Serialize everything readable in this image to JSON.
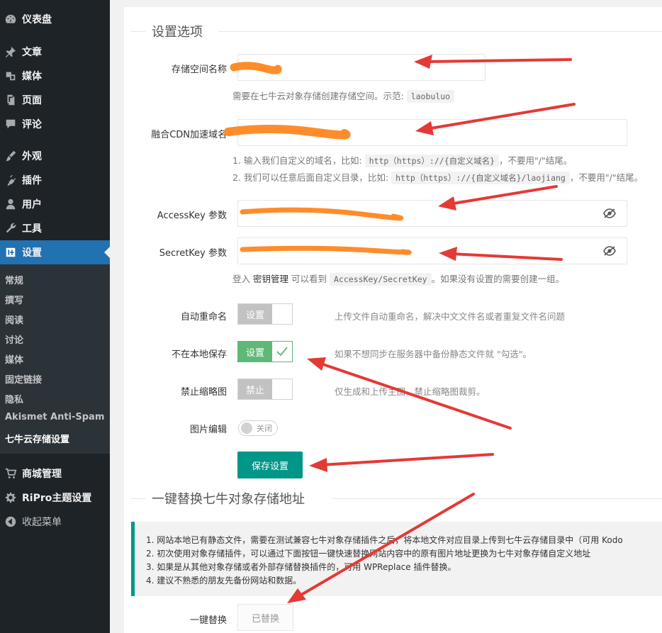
{
  "sidebar": {
    "items": [
      {
        "label": "仪表盘",
        "icon": "dashboard-icon"
      },
      {
        "label": "文章",
        "icon": "pin-icon"
      },
      {
        "label": "媒体",
        "icon": "media-icon"
      },
      {
        "label": "页面",
        "icon": "page-icon"
      },
      {
        "label": "评论",
        "icon": "comment-icon"
      },
      {
        "label": "外观",
        "icon": "brush-icon"
      },
      {
        "label": "插件",
        "icon": "plugin-icon"
      },
      {
        "label": "用户",
        "icon": "user-icon"
      },
      {
        "label": "工具",
        "icon": "wrench-icon"
      },
      {
        "label": "设置",
        "icon": "settings-icon"
      },
      {
        "label": "商城管理",
        "icon": "cart-icon"
      },
      {
        "label": "RiPro主题设置",
        "icon": "gear-icon"
      },
      {
        "label": "收起菜单",
        "icon": "collapse-icon"
      }
    ],
    "submenu": [
      "常规",
      "撰写",
      "阅读",
      "讨论",
      "媒体",
      "固定链接",
      "隐私",
      "Akismet Anti-Spam",
      "七牛云存储设置"
    ]
  },
  "settings": {
    "legend": "设置选项",
    "bucket": {
      "label": "存储空间名称",
      "help_prefix": "需要在七牛云对象存储创建存储空间。示范:",
      "help_code": "laobuluo"
    },
    "cdn": {
      "label": "融合CDN加速域名",
      "help1_prefix": "1. 输入我们自定义的域名，比如:",
      "help1_code": "http（https）://{自定义域名}",
      "help1_suffix": "，不要用\"/\"结尾。",
      "help2_prefix": "2. 我们可以任意后面自定义目录，比如:",
      "help2_code": "http（https）://{自定义域名}/laojiang",
      "help2_suffix": "，不要用\"/\"结尾。"
    },
    "access_key": {
      "label": "AccessKey 参数"
    },
    "secret_key": {
      "label": "SecretKey 参数"
    },
    "key_help": {
      "prefix": "登入",
      "link": "密钥管理",
      "middle": "可以看到",
      "code": "AccessKey/SecretKey",
      "suffix": "。如果没有设置的需要创建一组。"
    },
    "auto_rename": {
      "label": "自动重命名",
      "switch_text": "设置",
      "checked": false,
      "help": "上传文件自动重命名，解决中文文件名或者重复文件名问题"
    },
    "no_local": {
      "label": "不在本地保存",
      "switch_text": "设置",
      "checked": true,
      "help": "如果不想同步在服务器中备份静态文件就 \"勾选\"。"
    },
    "no_thumb": {
      "label": "禁止缩略图",
      "switch_text": "禁止",
      "checked": false,
      "help": "仅生成和上传主图，禁止缩略图裁剪。"
    },
    "image_edit": {
      "label": "图片编辑",
      "toggle_text": "关闭"
    },
    "save_button": "保存设置"
  },
  "replace": {
    "legend": "一键替换七牛对象存储地址",
    "notice": [
      "1. 网站本地已有静态文件，需要在测试兼容七牛对象存储插件之后，将本地文件对应目录上传到七牛云存储目录中（可用 Kodo",
      "2. 初次使用对象存储插件，可以通过下面按钮一键快速替换网站内容中的原有图片地址更换为七牛对象存储自定义地址",
      "3. 如果是从其他对象存储或者外部存储替换插件的，可用 WPReplace 插件替换。",
      "4. 建议不熟悉的朋友先备份网站和数据。"
    ],
    "label": "一键替换",
    "button": "已替换"
  },
  "colors": {
    "sidebar_bg": "#1d2327",
    "active": "#2271b1",
    "primary": "#009688",
    "switch_on": "#5fb878",
    "arrow": "#e53935",
    "redaction": "#ff8c2a"
  }
}
